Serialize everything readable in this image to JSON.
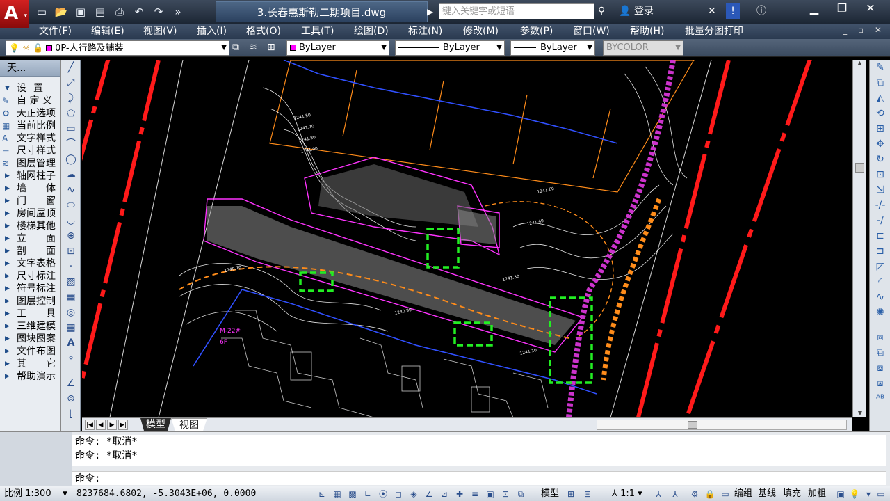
{
  "titlebar": {
    "document_title": "3.长春惠斯勒二期项目.dwg",
    "search_placeholder": "键入关键字或短语",
    "login_label": "登录"
  },
  "menus": [
    "文件(F)",
    "编辑(E)",
    "视图(V)",
    "插入(I)",
    "格式(O)",
    "工具(T)",
    "绘图(D)",
    "标注(N)",
    "修改(M)",
    "参数(P)",
    "窗口(W)",
    "帮助(H)",
    "批量分图打印"
  ],
  "properties": {
    "layer": "0P-人行路及铺装",
    "color": "ByLayer",
    "linetype": "ByLayer",
    "lineweight": "ByLayer",
    "plotstyle": "BYCOLOR"
  },
  "left_panel": {
    "title": "天...",
    "items": [
      {
        "label": "设置",
        "type": "section"
      },
      {
        "label": "自 定 义",
        "type": "icon"
      },
      {
        "label": "天正选项",
        "type": "icon"
      },
      {
        "label": "当前比例",
        "type": "icon"
      },
      {
        "label": "文字样式",
        "type": "icon"
      },
      {
        "label": "尺寸样式",
        "type": "icon"
      },
      {
        "label": "图层管理",
        "type": "icon"
      },
      {
        "label": "轴网柱子",
        "type": "tri"
      },
      {
        "label": "墙　　体",
        "type": "tri"
      },
      {
        "label": "门　　窗",
        "type": "tri"
      },
      {
        "label": "房间屋顶",
        "type": "tri"
      },
      {
        "label": "楼梯其他",
        "type": "tri"
      },
      {
        "label": "立　　面",
        "type": "tri"
      },
      {
        "label": "剖　　面",
        "type": "tri"
      },
      {
        "label": "文字表格",
        "type": "tri"
      },
      {
        "label": "尺寸标注",
        "type": "tri"
      },
      {
        "label": "符号标注",
        "type": "tri"
      },
      {
        "label": "图层控制",
        "type": "tri"
      },
      {
        "label": "工　　具",
        "type": "tri"
      },
      {
        "label": "三维建模",
        "type": "tri"
      },
      {
        "label": "图块图案",
        "type": "tri"
      },
      {
        "label": "文件布图",
        "type": "tri"
      },
      {
        "label": "其　　它",
        "type": "tri"
      },
      {
        "label": "帮助演示",
        "type": "tri"
      }
    ]
  },
  "drawing": {
    "building_label": "M-22#",
    "floors_label": "6F",
    "elevations": [
      "1241.50",
      "1241.70",
      "1241.80",
      "1241.90",
      "1241.60",
      "1241.40",
      "1241.30",
      "1240.90",
      "1240.70",
      "1241.10"
    ]
  },
  "tabs": {
    "model": "模型",
    "layout": "视图"
  },
  "command": {
    "history": [
      "命令: *取消*",
      "命令: *取消*"
    ],
    "prompt": "命令:"
  },
  "status": {
    "scale": "比例 1:300",
    "coords": "8237684.6802, -5.3043E+06, 0.0000",
    "model_label": "模型",
    "annot_scale": "1:1",
    "right_labels": [
      "编组",
      "基线",
      "填充",
      "加粗"
    ]
  }
}
